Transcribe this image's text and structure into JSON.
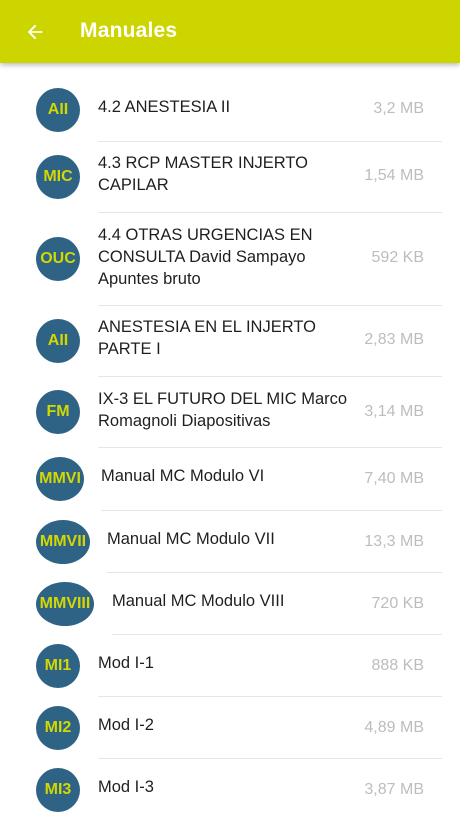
{
  "appbar": {
    "title": "Manuales",
    "back_icon": "arrow-left-icon",
    "color": "#cdd500"
  },
  "avatar_colors": {
    "background": "#2e6386",
    "text": "#d2d800"
  },
  "files": [
    {
      "initials": "AII",
      "title": "4.2 ANESTESIA II",
      "size": "3,2 MB"
    },
    {
      "initials": "MIC",
      "title": "4.3 RCP MASTER INJERTO CAPILAR",
      "size": "1,54 MB"
    },
    {
      "initials": "OUC",
      "title": "4.4 OTRAS URGENCIAS EN CONSULTA David Sampayo Apuntes bruto",
      "size": "592 KB"
    },
    {
      "initials": "AII",
      "title": "ANESTESIA EN EL INJERTO PARTE I",
      "size": "2,83 MB"
    },
    {
      "initials": "FM",
      "title": "IX-3 EL FUTURO DEL MIC Marco Romagnoli Diapositivas",
      "size": "3,14 MB"
    },
    {
      "initials": "MMVI",
      "title": "Manual MC Modulo VI",
      "size": "7,40 MB"
    },
    {
      "initials": "MMVII",
      "title": "Manual MC Modulo VII",
      "size": "13,3 MB"
    },
    {
      "initials": "MMVIII",
      "title": "Manual MC Modulo VIII",
      "size": "720 KB"
    },
    {
      "initials": "MI1",
      "title": "Mod I-1",
      "size": "888 KB"
    },
    {
      "initials": "MI2",
      "title": "Mod I-2",
      "size": "4,89 MB"
    },
    {
      "initials": "MI3",
      "title": "Mod I-3",
      "size": "3,87 MB"
    }
  ]
}
